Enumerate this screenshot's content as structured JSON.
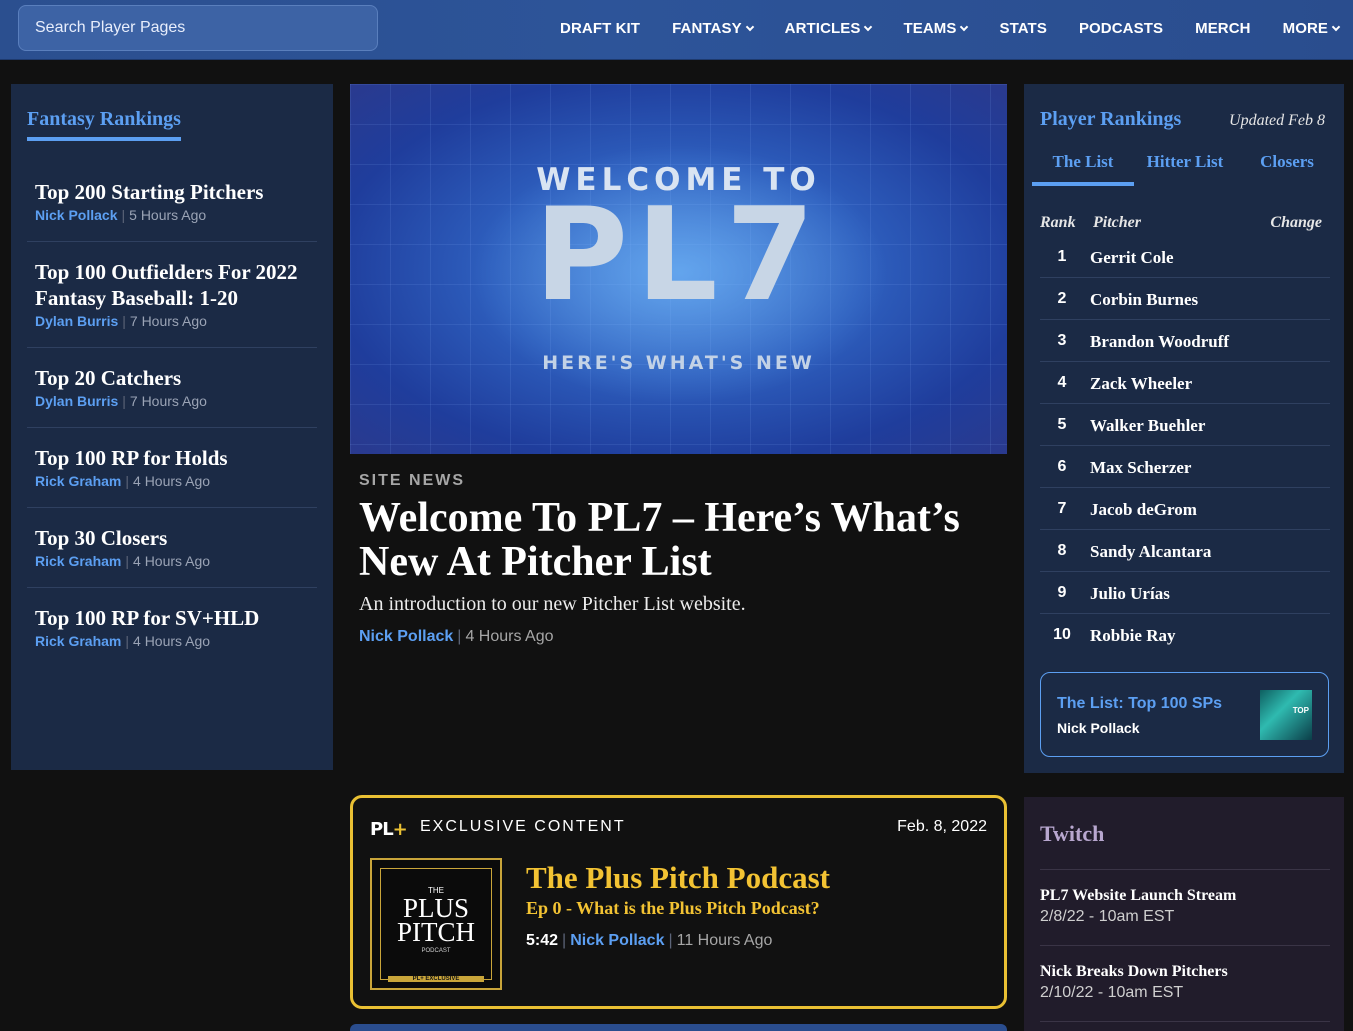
{
  "header": {
    "search_placeholder": "Search Player Pages",
    "nav": [
      {
        "label": "DRAFT KIT",
        "dropdown": false
      },
      {
        "label": "FANTASY",
        "dropdown": true
      },
      {
        "label": "ARTICLES",
        "dropdown": true
      },
      {
        "label": "TEAMS",
        "dropdown": true
      },
      {
        "label": "STATS",
        "dropdown": false
      },
      {
        "label": "PODCASTS",
        "dropdown": false
      },
      {
        "label": "MERCH",
        "dropdown": false
      },
      {
        "label": "MORE",
        "dropdown": true
      }
    ]
  },
  "fantasy_rankings": {
    "title": "Fantasy Rankings",
    "items": [
      {
        "title": "Top 200 Starting Pitchers",
        "author": "Nick Pollack",
        "time": "5 Hours Ago"
      },
      {
        "title": "Top 100 Outfielders For 2022 Fantasy Baseball: 1-20",
        "author": "Dylan Burris",
        "time": "7 Hours Ago"
      },
      {
        "title": "Top 20 Catchers",
        "author": "Dylan Burris",
        "time": "7 Hours Ago"
      },
      {
        "title": "Top 100 RP for Holds",
        "author": "Rick Graham",
        "time": "4 Hours Ago"
      },
      {
        "title": "Top 30 Closers",
        "author": "Rick Graham",
        "time": "4 Hours Ago"
      },
      {
        "title": "Top 100 RP for SV+HLD",
        "author": "Rick Graham",
        "time": "4 Hours Ago"
      }
    ]
  },
  "hero": {
    "image_welcome": "WELCOME TO",
    "image_logo": "PL7",
    "image_sub": "HERE'S WHAT'S NEW",
    "category": "SITE NEWS",
    "title": "Welcome To PL7 – Here’s What’s New At Pitcher List",
    "description": "An introduction to our new Pitcher List website.",
    "author": "Nick Pollack",
    "time": "4 Hours Ago"
  },
  "player_rankings": {
    "title": "Player Rankings",
    "updated": "Updated Feb 8",
    "tabs": [
      {
        "label": "The List",
        "active": true
      },
      {
        "label": "Hitter List",
        "active": false
      },
      {
        "label": "Closers",
        "active": false
      }
    ],
    "columns": {
      "rank": "Rank",
      "pitcher": "Pitcher",
      "change": "Change"
    },
    "rows": [
      {
        "rank": "1",
        "name": "Gerrit Cole"
      },
      {
        "rank": "2",
        "name": "Corbin Burnes"
      },
      {
        "rank": "3",
        "name": "Brandon Woodruff"
      },
      {
        "rank": "4",
        "name": "Zack Wheeler"
      },
      {
        "rank": "5",
        "name": "Walker Buehler"
      },
      {
        "rank": "6",
        "name": "Max Scherzer"
      },
      {
        "rank": "7",
        "name": "Jacob deGrom"
      },
      {
        "rank": "8",
        "name": "Sandy Alcantara"
      },
      {
        "rank": "9",
        "name": "Julio Urías"
      },
      {
        "rank": "10",
        "name": "Robbie Ray"
      }
    ],
    "card": {
      "title": "The List: Top 100 SPs",
      "author": "Nick Pollack",
      "thumb_text": "TOP"
    }
  },
  "exclusive": {
    "logo_text": "PL",
    "logo_plus": "+",
    "label": "EXCLUSIVE CONTENT",
    "date": "Feb. 8, 2022",
    "art": {
      "the": "THE",
      "plus": "PLUS",
      "pitch": "PITCH",
      "podcast": "PODCAST",
      "badge": "PL+ EXCLUSIVE"
    },
    "title": "The Plus Pitch Podcast",
    "subtitle": "Ep 0 - What is the Plus Pitch Podcast?",
    "duration": "5:42",
    "author": "Nick Pollack",
    "time": "11 Hours Ago"
  },
  "twitch": {
    "title": "Twitch",
    "items": [
      {
        "title": "PL7 Website Launch Stream",
        "date": "2/8/22 - 10am EST"
      },
      {
        "title": "Nick Breaks Down Pitchers",
        "date": "2/10/22 - 10am EST"
      }
    ]
  },
  "colors": {
    "accent_blue": "#5c9ff2",
    "panel_bg": "#1b2a45",
    "gold": "#e9c033",
    "twitch_bg": "#211c2b"
  }
}
